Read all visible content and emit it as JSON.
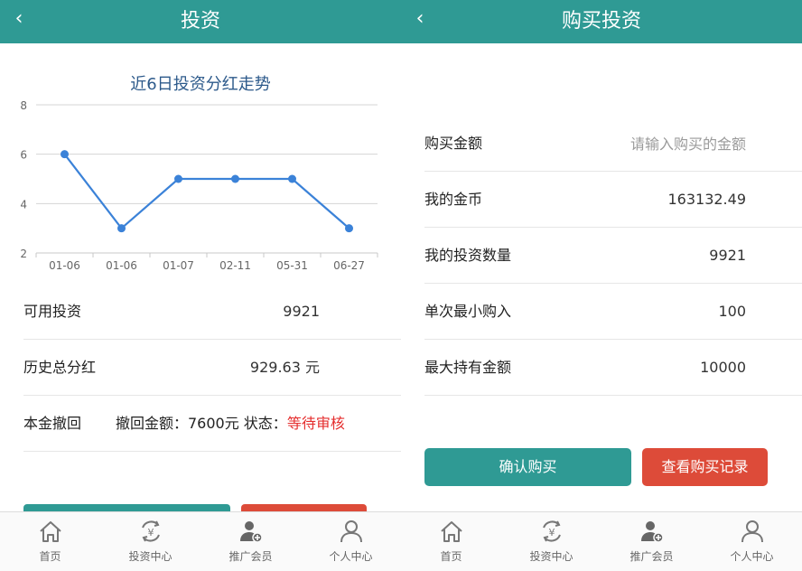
{
  "left": {
    "header": {
      "back": "‹",
      "title": "投资"
    },
    "chart_title": "近6日投资分红走势",
    "rows": [
      {
        "label": "可用投资",
        "value": "9921"
      },
      {
        "label": "历史总分红",
        "value": "929.63 元"
      }
    ],
    "withdraw": {
      "label": "本金撤回",
      "detail": "撤回金额：7600元 状态：",
      "status": "等待审核"
    }
  },
  "right": {
    "header": {
      "back": "‹",
      "title": "购买投资"
    },
    "amount": {
      "label": "购买金额",
      "placeholder": "请输入购买的金额"
    },
    "rows": [
      {
        "label": "我的金币",
        "value": "163132.49"
      },
      {
        "label": "我的投资数量",
        "value": "9921"
      },
      {
        "label": "单次最小购入",
        "value": "100"
      },
      {
        "label": "最大持有金额",
        "value": "10000"
      }
    ],
    "buttons": {
      "confirm": "确认购买",
      "records": "查看购买记录"
    }
  },
  "tabbar": [
    {
      "label": "首页",
      "icon": "home-icon"
    },
    {
      "label": "投资中心",
      "icon": "yuan-cycle-icon"
    },
    {
      "label": "推广会员",
      "icon": "add-member-icon"
    },
    {
      "label": "个人中心",
      "icon": "person-icon"
    }
  ],
  "colors": {
    "primary": "#2f9a94",
    "danger": "#dd4b39",
    "chart_line": "#3b82d8",
    "chart_title": "#2d5a8b",
    "status_red": "#e52e2e"
  },
  "chart_data": {
    "type": "line",
    "categories": [
      "01-06",
      "01-06",
      "01-07",
      "02-11",
      "05-31",
      "06-27"
    ],
    "values": [
      6,
      3,
      5,
      5,
      5,
      3
    ],
    "title": "近6日投资分红走势",
    "ylim": [
      2,
      8
    ],
    "yticks": [
      2,
      4,
      6,
      8
    ],
    "grid": true
  }
}
